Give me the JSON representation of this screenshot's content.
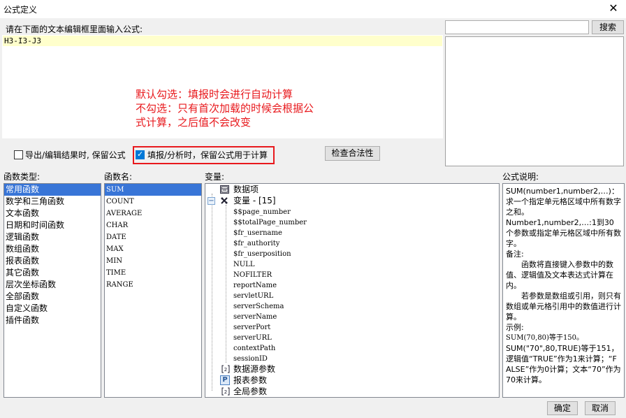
{
  "window": {
    "title": "公式定义",
    "close_glyph": "✕"
  },
  "editor": {
    "prompt": "请在下面的文本编辑框里面输入公式:",
    "formula": "H3-I3-J3"
  },
  "annotation": {
    "line1": "默认勾选：填报时会进行自动计算",
    "line2": "不勾选：只有首次加载的时候会根据公",
    "line3": "式计算，之后值不会改变"
  },
  "search": {
    "value": "",
    "button": "搜索"
  },
  "options": {
    "keep_formula_export": {
      "label": "导出/编辑结果时, 保留公式",
      "checked": false
    },
    "keep_formula_fill": {
      "label": "填报/分析时，保留公式用于计算",
      "checked": true
    },
    "check_button": "检查合法性"
  },
  "func_types": {
    "header": "函数类型:",
    "items": [
      "常用函数",
      "数学和三角函数",
      "文本函数",
      "日期和时间函数",
      "逻辑函数",
      "数组函数",
      "报表函数",
      "其它函数",
      "层次坐标函数",
      "全部函数",
      "自定义函数",
      "插件函数"
    ],
    "selected": "常用函数"
  },
  "func_names": {
    "header": "函数名:",
    "items": [
      "SUM",
      "COUNT",
      "AVERAGE",
      "CHAR",
      "DATE",
      "MAX",
      "MIN",
      "TIME",
      "RANGE"
    ],
    "selected": "SUM"
  },
  "variables": {
    "header": "变量:",
    "data_item": "数据项",
    "var_group": "变量 - [15]",
    "var_items": [
      "$$page_number",
      "$$totalPage_number",
      "$fr_username",
      "$fr_authority",
      "$fr_userposition",
      "NULL",
      "NOFILTER",
      "reportName",
      "servletURL",
      "serverSchema",
      "serverName",
      "serverPort",
      "serverURL",
      "contextPath",
      "sessionID"
    ],
    "datasource_params": "数据源参数",
    "report_params": "报表参数",
    "global_params": "全局参数",
    "collapse_glyph": "−"
  },
  "description": {
    "header": "公式说明:",
    "l1": "SUM(number1,number2,…)：求一个指定单元格区域中所有数字之和。",
    "l2": "Number1,number2,…:1到30个参数或指定单元格区域中所有数字。",
    "l3": "备注:",
    "l4": "函数将直接键入参数中的数值、逻辑值及文本表达式计算在内。",
    "l5": "若参数是数组或引用，则只有数组或单元格引用中的数值进行计算。",
    "l6": "示例:",
    "l7": "SUM(70,80)等于150。",
    "l8": "SUM(\"70\",80,TRUE)等于151，逻辑值“TRUE”作为1来计算；“FALSE”作为0计算；文本“70”作为70来计算。"
  },
  "footer": {
    "ok": "确定",
    "cancel": "取消"
  },
  "colors": {
    "selection": "#3875d7",
    "annotation": "#e8191d",
    "editor_highlight": "#ffffcc"
  },
  "icons": {
    "data_item": "table-icon",
    "var_group": "variable-icon",
    "datasource_params": "parameter-icon",
    "report_params": "p-icon",
    "global_params": "parameter-icon"
  }
}
